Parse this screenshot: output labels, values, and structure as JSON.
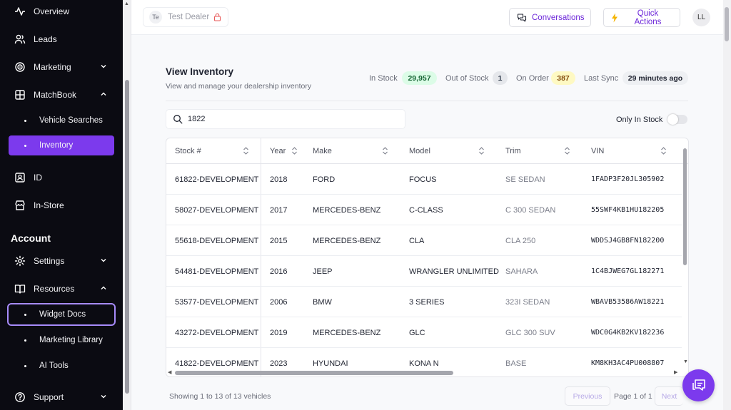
{
  "colors": {
    "accent": "#7c3aed",
    "sidebar_bg": "#0b0b12",
    "in_stock_badge": "#dcfce7",
    "out_of_stock_badge": "#e5e7eb",
    "on_order_badge": "#fef9c3"
  },
  "sidebar": {
    "items": [
      {
        "label": "Overview",
        "icon": "activity-icon"
      },
      {
        "label": "Leads",
        "icon": "users-icon"
      },
      {
        "label": "Marketing",
        "icon": "target-icon",
        "expandable": true
      },
      {
        "label": "MatchBook",
        "icon": "grid-icon",
        "expandable": true,
        "expanded": true
      },
      {
        "label": "ID",
        "icon": "id-card-icon"
      },
      {
        "label": "In-Store",
        "icon": "store-icon"
      }
    ],
    "matchbook_sub": [
      {
        "label": "Vehicle Searches"
      },
      {
        "label": "Inventory",
        "active": true
      }
    ],
    "account_heading": "Account",
    "account_items": [
      {
        "label": "Settings",
        "icon": "gear-icon",
        "expandable": true
      },
      {
        "label": "Resources",
        "icon": "book-icon",
        "expandable": true,
        "expanded": true
      }
    ],
    "resources_sub": [
      {
        "label": "Widget Docs",
        "focused": true
      },
      {
        "label": "Marketing Library"
      },
      {
        "label": "AI Tools"
      }
    ],
    "support": {
      "label": "Support",
      "icon": "help-circle-icon"
    }
  },
  "header": {
    "dealer_initials": "Te",
    "dealer_name": "Test Dealer",
    "conversations_label": "Conversations",
    "quick_actions_label": "Quick Actions",
    "user_initials": "LL"
  },
  "inventory": {
    "title": "View Inventory",
    "subtitle": "View and manage your dealership inventory",
    "stats": {
      "in_stock_label": "In Stock",
      "in_stock_value": "29,957",
      "out_of_stock_label": "Out of Stock",
      "out_of_stock_value": "1",
      "on_order_label": "On Order",
      "on_order_value": "387",
      "last_sync_label": "Last Sync",
      "last_sync_value": "29 minutes ago"
    },
    "search_value": "1822",
    "only_in_stock_label": "Only In Stock",
    "only_in_stock_checked": false
  },
  "table": {
    "columns": [
      "Stock #",
      "Year",
      "Make",
      "Model",
      "Trim",
      "VIN"
    ],
    "rows": [
      [
        "61822-DEVELOPMENT",
        "2018",
        "FORD",
        "FOCUS",
        "SE SEDAN",
        "1FADP3F20JL305902"
      ],
      [
        "58027-DEVELOPMENT",
        "2017",
        "MERCEDES-BENZ",
        "C-CLASS",
        "C 300 SEDAN",
        "55SWF4KB1HU182205"
      ],
      [
        "55618-DEVELOPMENT",
        "2015",
        "MERCEDES-BENZ",
        "CLA",
        "CLA 250",
        "WDDSJ4GB8FN182200"
      ],
      [
        "54481-DEVELOPMENT",
        "2016",
        "JEEP",
        "WRANGLER UNLIMITED",
        "SAHARA",
        "1C4BJWEG7GL182271"
      ],
      [
        "53577-DEVELOPMENT",
        "2006",
        "BMW",
        "3 SERIES",
        "323I SEDAN",
        "WBAVB53586AW18221"
      ],
      [
        "43272-DEVELOPMENT",
        "2019",
        "MERCEDES-BENZ",
        "GLC",
        "GLC 300 SUV",
        "WDC0G4KB2KV182236"
      ],
      [
        "41822-DEVELOPMENT",
        "2023",
        "HYUNDAI",
        "KONA N",
        "BASE",
        "KM8KH3AC4PU008807"
      ]
    ]
  },
  "pagination": {
    "showing": "Showing 1 to 13 of 13 vehicles",
    "previous": "Previous",
    "page_text": "Page 1 of 1",
    "next": "Next"
  }
}
